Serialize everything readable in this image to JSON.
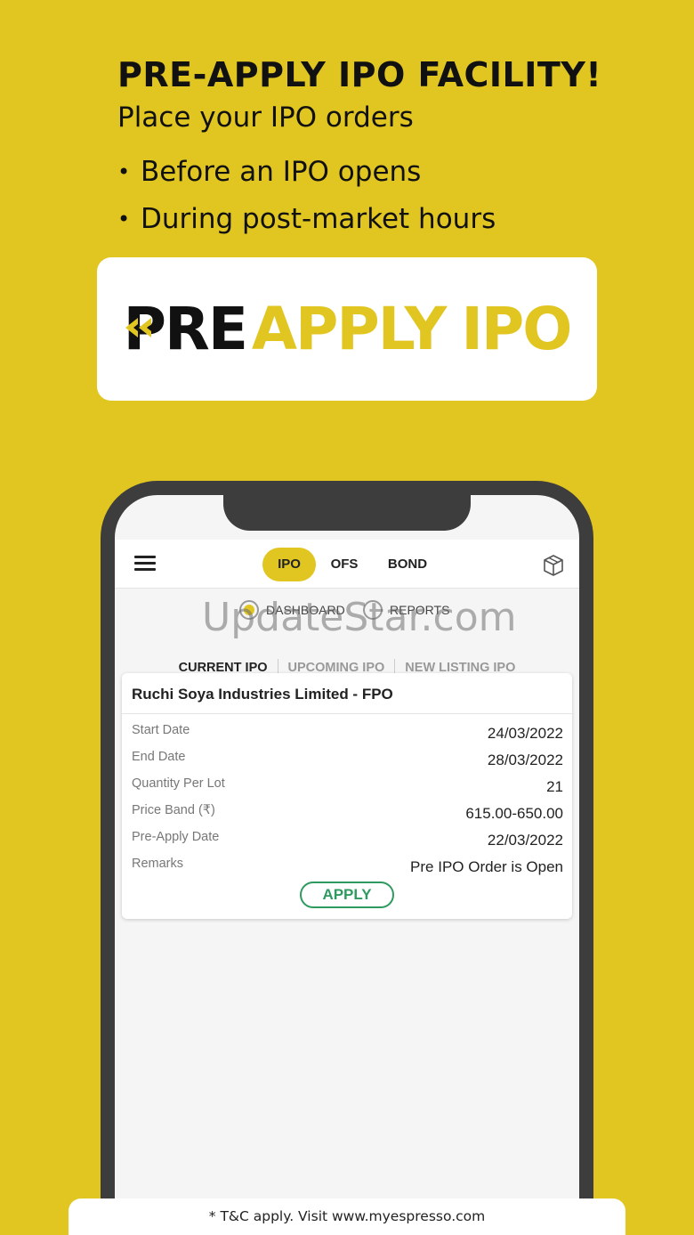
{
  "promo": {
    "headline": "PRE-APPLY IPO FACILITY!",
    "subline": "Place your IPO orders",
    "bullets": [
      "Before an IPO opens",
      "During post-market hours"
    ]
  },
  "logo": {
    "pre": "PRE",
    "apply": "APPLY",
    "ipo": "IPO"
  },
  "app": {
    "tabs": [
      "IPO",
      "OFS",
      "BOND"
    ],
    "active_tab": "IPO",
    "radios": [
      {
        "label": "DASHBOARD",
        "selected": true
      },
      {
        "label": "REPORTS",
        "selected": false
      }
    ],
    "subtabs": [
      "CURRENT IPO",
      "UPCOMING IPO",
      "NEW LISTING IPO"
    ],
    "active_subtab": "CURRENT IPO",
    "card": {
      "title": "Ruchi Soya Industries Limited - FPO",
      "rows": [
        {
          "label": "Start Date",
          "value": "24/03/2022"
        },
        {
          "label": "End Date",
          "value": "28/03/2022"
        },
        {
          "label": "Quantity Per Lot",
          "value": "21"
        },
        {
          "label": "Price Band (₹)",
          "value": "615.00-650.00"
        },
        {
          "label": "Pre-Apply Date",
          "value": "22/03/2022"
        },
        {
          "label": "Remarks",
          "value": "Pre IPO Order is Open"
        }
      ],
      "apply_label": "APPLY"
    }
  },
  "watermark": "UpdateStar.com",
  "footer": "* T&C apply. Visit www.myespresso.com",
  "colors": {
    "brand_yellow": "#e1c622",
    "apply_green": "#2e9a5f",
    "phone_frame": "#3d3d3d"
  }
}
